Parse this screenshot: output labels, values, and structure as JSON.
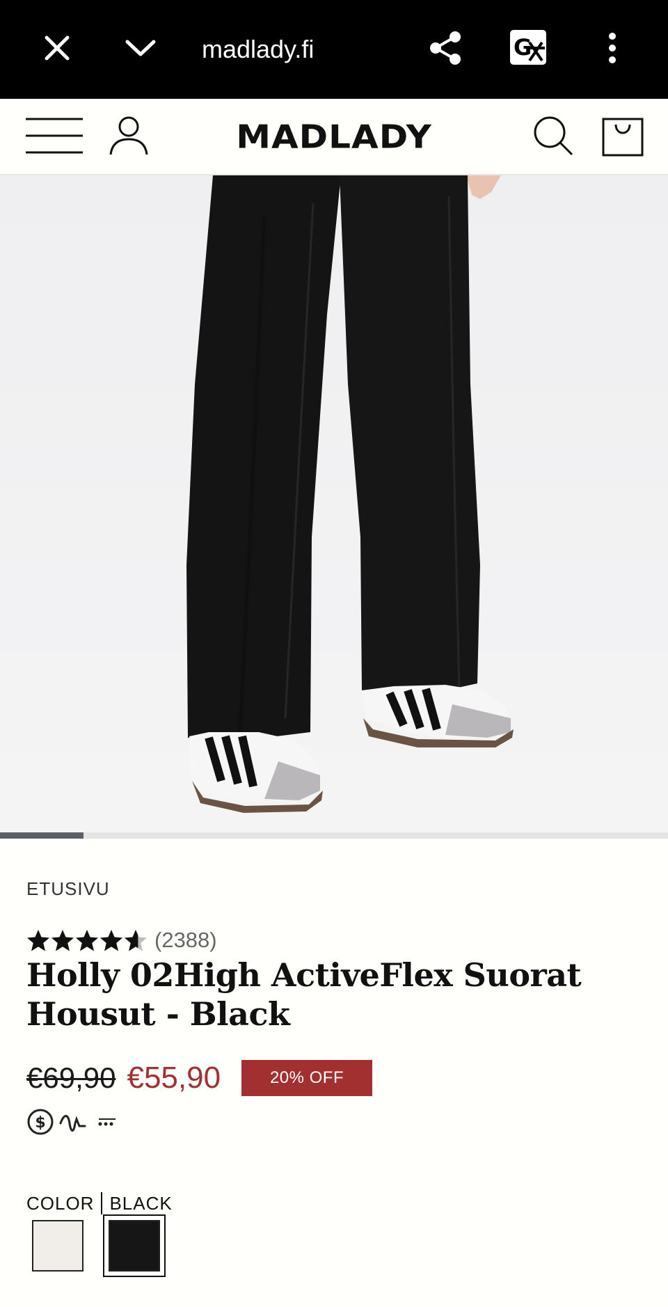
{
  "browser": {
    "url": "madlady.fi",
    "close_icon": "close-icon",
    "chevron_icon": "chevron-down-icon",
    "share_icon": "share-icon",
    "translate_icon": "translate-icon",
    "more_icon": "more-vertical-icon"
  },
  "header": {
    "logo": "MADLADY",
    "menu_icon": "hamburger-menu-icon",
    "account_icon": "account-icon",
    "search_icon": "search-icon",
    "cart_icon": "shopping-bag-icon"
  },
  "gallery": {
    "current_slide_fraction": 0.125
  },
  "product": {
    "breadcrumb": "ETUSIVU",
    "rating": 4.6,
    "rating_count": "(2388)",
    "title": "Holly 02High ActiveFlex Suorat Housut - Black",
    "price_original": "€69,90",
    "price_sale": "€55,90",
    "discount_badge": "20% OFF",
    "payment_icons": [
      "dollar-circle-icon",
      "squiggle-icon",
      "dots-icon"
    ],
    "color_label": "COLOR",
    "color_value": "BLACK",
    "swatches": [
      {
        "name": "off-white",
        "color": "#f1ede8",
        "selected": false
      },
      {
        "name": "black",
        "color": "#161616",
        "selected": true
      }
    ]
  },
  "colors": {
    "accent_red": "#a33030",
    "browser_bar": "#000000",
    "page_bg": "#fffffb"
  }
}
